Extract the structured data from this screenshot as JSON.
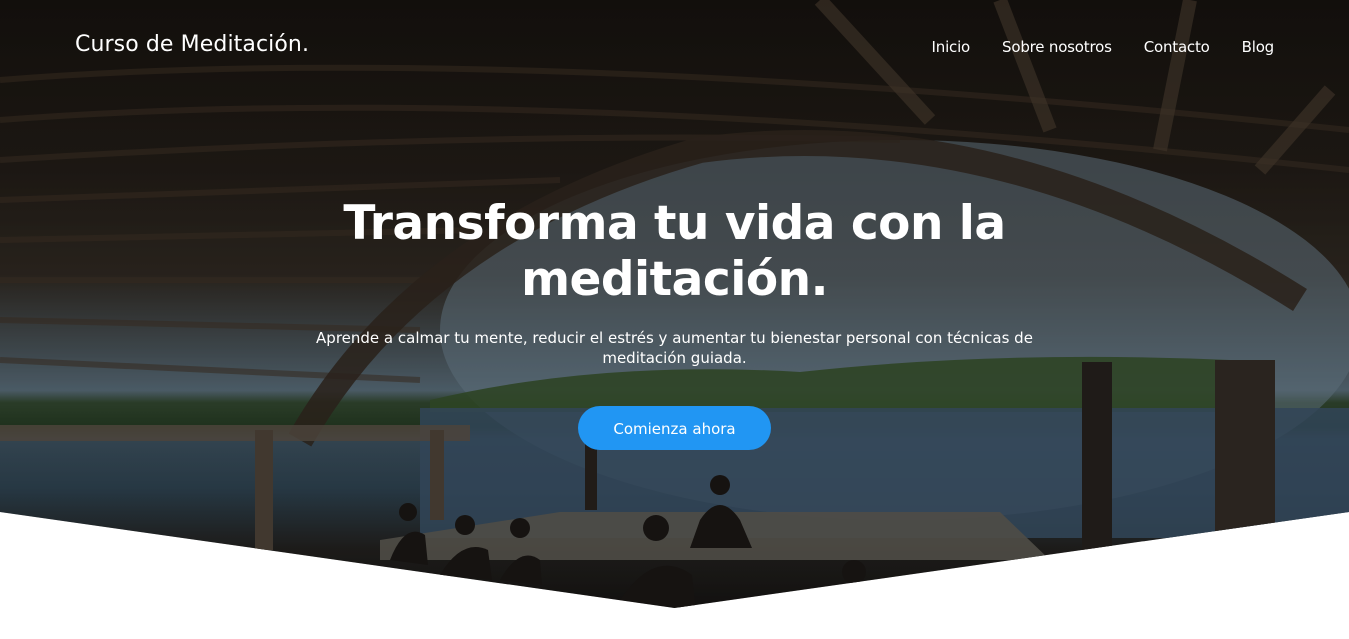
{
  "header": {
    "brand": "Curso de Meditación.",
    "nav": [
      {
        "label": "Inicio"
      },
      {
        "label": "Sobre nosotros"
      },
      {
        "label": "Contacto"
      },
      {
        "label": "Blog"
      }
    ]
  },
  "hero": {
    "headline": "Transforma tu vida con la meditación.",
    "subtitle": "Aprende a calmar tu mente, reducir el estrés y aumentar tu bienestar personal con técnicas de meditación guiada.",
    "cta_label": "Comienza ahora",
    "background_image": "meditation-group-under-thatched-roof-by-lagoon"
  },
  "colors": {
    "accent": "#2196f3",
    "text": "#ffffff",
    "page_background": "#ffffff"
  }
}
